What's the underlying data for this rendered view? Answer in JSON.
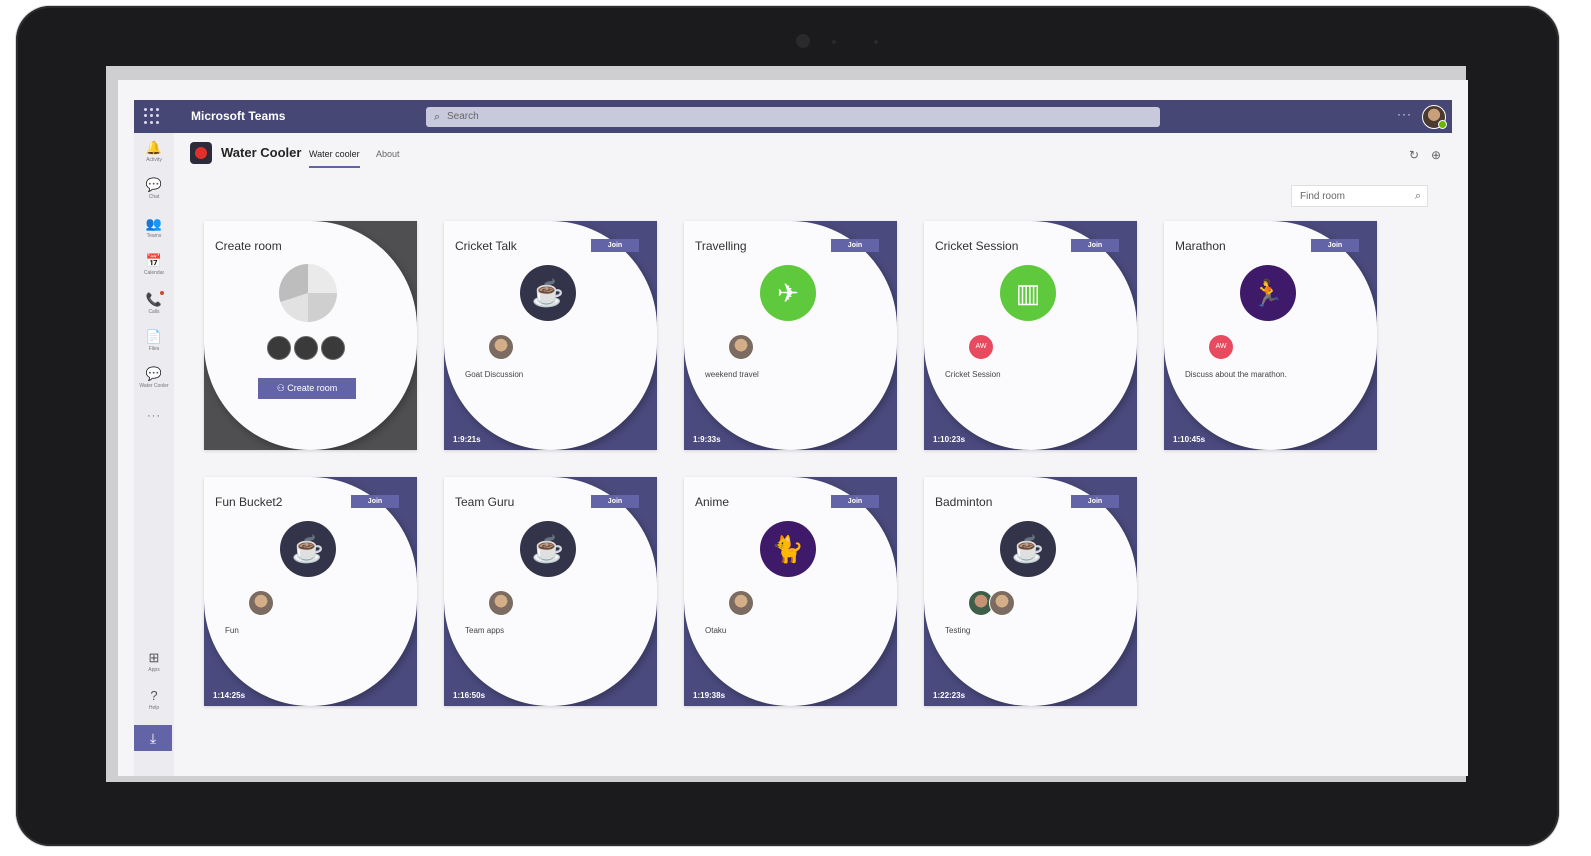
{
  "app": {
    "brand": "Microsoft Teams",
    "search_placeholder": "Search",
    "more": "···"
  },
  "rail": [
    {
      "name": "activity",
      "glyph": "🔔",
      "label": "Activity"
    },
    {
      "name": "chat",
      "glyph": "💬",
      "label": "Chat"
    },
    {
      "name": "teams",
      "glyph": "👥",
      "label": "Teams"
    },
    {
      "name": "calendar",
      "glyph": "📅",
      "label": "Calendar"
    },
    {
      "name": "calls",
      "glyph": "📞",
      "label": "Calls"
    },
    {
      "name": "files",
      "glyph": "📄",
      "label": "Files"
    },
    {
      "name": "water-cooler",
      "glyph": "💬",
      "label": "Water Cooler"
    },
    {
      "name": "apps",
      "glyph": "⊞",
      "label": "Apps"
    },
    {
      "name": "help",
      "glyph": "?",
      "label": "Help"
    }
  ],
  "header": {
    "title": "Water Cooler",
    "tabs": [
      "Water cooler",
      "About"
    ]
  },
  "find_room_placeholder": "Find room",
  "create": {
    "title": "Create room",
    "button": "Create room"
  },
  "join_label": "Join",
  "rooms": [
    {
      "title": "Cricket Talk",
      "desc": "Goat Discussion",
      "timer": "1:9:21s",
      "icon": "tea-icon",
      "color": "#33344a",
      "avatars": [
        "photo"
      ]
    },
    {
      "title": "Travelling",
      "desc": "weekend travel",
      "timer": "1:9:33s",
      "icon": "airplane-icon",
      "color": "#5fc93d",
      "avatars": [
        "photo"
      ]
    },
    {
      "title": "Cricket Session",
      "desc": "Cricket Session",
      "timer": "1:10:23s",
      "icon": "buildings-icon",
      "color": "#5fc93d",
      "avatars": [
        "AW"
      ]
    },
    {
      "title": "Marathon",
      "desc": "Discuss about the marathon.",
      "timer": "1:10:45s",
      "icon": "runner-icon",
      "color": "#3f1a6b",
      "avatars": [
        "AW"
      ]
    },
    {
      "title": "Fun Bucket2",
      "desc": "Fun",
      "timer": "1:14:25s",
      "icon": "tea-icon",
      "color": "#33344a",
      "avatars": [
        "photo"
      ]
    },
    {
      "title": "Team Guru",
      "desc": "Team apps",
      "timer": "1:16:50s",
      "icon": "tea-icon",
      "color": "#33344a",
      "avatars": [
        "photo"
      ]
    },
    {
      "title": "Anime",
      "desc": "Otaku",
      "timer": "1:19:38s",
      "icon": "cat-icon",
      "color": "#3f1a6b",
      "avatars": [
        "photo"
      ]
    },
    {
      "title": "Badminton",
      "desc": "Testing",
      "timer": "1:22:23s",
      "icon": "tea-icon",
      "color": "#33344a",
      "avatars": [
        "photo",
        "photo"
      ]
    }
  ]
}
